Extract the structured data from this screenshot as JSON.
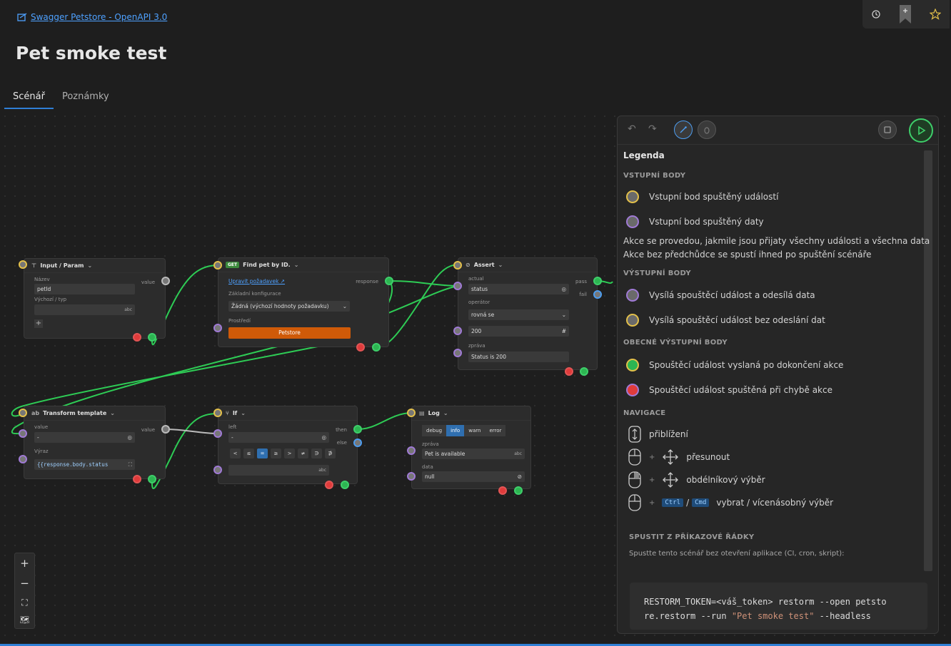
{
  "header": {
    "api_link": "Swagger Petstore - OpenAPI 3.0",
    "title": "Pet smoke test"
  },
  "tabs": [
    {
      "label": "Scénář",
      "active": true
    },
    {
      "label": "Poznámky",
      "active": false
    }
  ],
  "nodes": {
    "input_param": {
      "title": "Input / Param",
      "name_label": "Název",
      "name_value": "petId",
      "default_label": "Výchozí / typ",
      "type_badge": "abc",
      "value_port": "value"
    },
    "find_pet": {
      "method": "GET",
      "title": "Find pet by ID.",
      "edit_link": "Upravit požadavek",
      "response_port": "response",
      "config_label": "Základní konfigurace",
      "config_value": "Žádná (výchozí hodnoty požadavku)",
      "env_label": "Prostředí",
      "env_value": "Petstore"
    },
    "assert": {
      "title": "Assert",
      "actual_label": "actual",
      "actual_value": "status",
      "operator_label": "operátor",
      "operator_value": "rovná se",
      "expected_value": "200",
      "message_label": "zpráva",
      "message_value": "Status is 200",
      "pass_port": "pass",
      "fail_port": "fail"
    },
    "transform": {
      "title": "Transform template",
      "value_label": "value",
      "value_value": "-",
      "expr_label": "Výraz",
      "expr_value": "{{response.body.status",
      "value_port": "value"
    },
    "if_node": {
      "title": "If",
      "left_label": "left",
      "left_value": "-",
      "operators": [
        "<",
        "≤",
        "=",
        "≥",
        ">",
        "≠",
        "∋",
        "∌"
      ],
      "active_operator": "=",
      "right_type": "abc",
      "then_port": "then",
      "else_port": "else"
    },
    "log": {
      "title": "Log",
      "levels": [
        "debug",
        "info",
        "warn",
        "error"
      ],
      "active_level": "info",
      "message_label": "zpráva",
      "message_value": "Pet is available",
      "message_type": "abc",
      "data_label": "data",
      "data_value": "null"
    }
  },
  "zoom_controls": {
    "zoom_in": "+",
    "zoom_out": "−",
    "fit": "⛶",
    "map": "🗺"
  },
  "legend": {
    "title": "Legenda",
    "input_heading": "VSTUPNÍ BODY",
    "input_event": "Vstupní bod spuštěný událostí",
    "input_data": "Vstupní bod spuštěný daty",
    "note1": "Akce se provedou, jakmile jsou přijaty všechny události a všechna data",
    "note2": "Akce bez předchůdce se spustí ihned po spuštění scénáře",
    "output_heading": "VÝSTUPNÍ BODY",
    "output_with_data": "Vysílá spouštěcí událost a odesílá data",
    "output_without_data": "Vysílá spouštěcí událost bez odeslání dat",
    "general_heading": "OBECNÉ VÝSTUPNÍ BODY",
    "general_done": "Spouštěcí událost vyslaná po dokončení akce",
    "general_error": "Spouštěcí událost spuštěná při chybě akce",
    "nav_heading": "NAVIGACE",
    "nav_zoom": "přiblížení",
    "nav_move": "přesunout",
    "nav_rect": "obdélníkový výběr",
    "nav_ctrl": "Ctrl",
    "nav_sep": "/",
    "nav_cmd": "Cmd",
    "nav_multi": "vybrat / vícenásobný výběr",
    "plus": "+"
  },
  "cli": {
    "heading": "SPUSTIT Z PŘÍKAZOVÉ ŘÁDKY",
    "description": "Spustte tento scénář bez otevření aplikace (CI, cron, skript):",
    "cmd_prefix": "RESTORM_TOKEN=<váš_token> restorm --open petsto",
    "cmd_line2_a": "re.restorm --run ",
    "cmd_string": "\"Pet smoke test\"",
    "cmd_line2_b": " --headless"
  },
  "colors": {
    "accent": "#2f7fd6",
    "wire": "#2ecc55",
    "env_button": "#cf5a08",
    "run_button": "#3ecf6a"
  }
}
